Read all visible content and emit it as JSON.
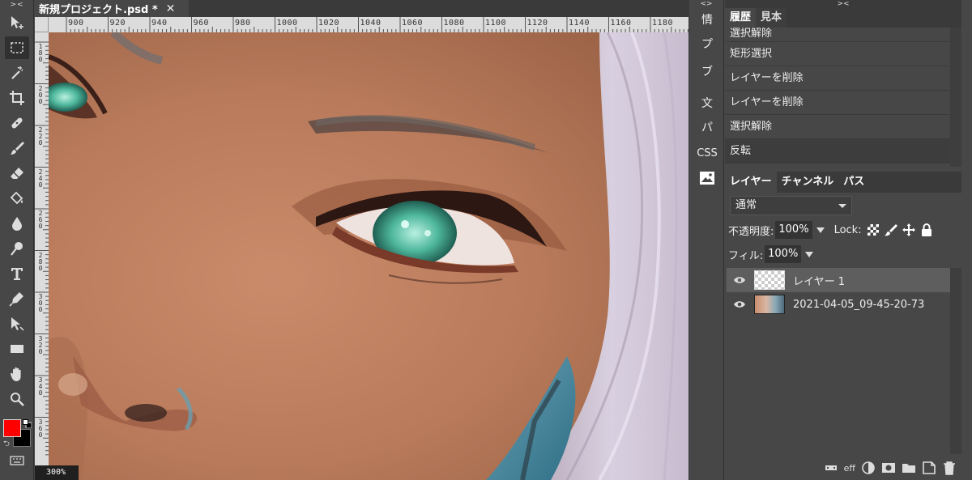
{
  "toolbar": {
    "collapse": "><",
    "tools": [
      "move",
      "marquee",
      "magic-wand",
      "crop",
      "healing",
      "brush",
      "eraser",
      "fill",
      "blur",
      "dodge",
      "type",
      "pen",
      "path-select",
      "shape",
      "hand",
      "zoom"
    ],
    "foreground_color": "#ff0000",
    "background_color": "#000000"
  },
  "document": {
    "tab_title": "新規プロジェクト.psd *",
    "close_glyph": "✕",
    "zoom": "300%"
  },
  "ruler": {
    "top_labels": [
      "900",
      "920",
      "940",
      "960",
      "980",
      "1000",
      "1020",
      "1040",
      "1060",
      "1080",
      "1100",
      "1120",
      "1140",
      "1160",
      "1180"
    ],
    "left_labels": [
      "180",
      "200",
      "220",
      "240",
      "260",
      "280",
      "300",
      "320",
      "340",
      "360"
    ]
  },
  "strip": {
    "collapse": "<>",
    "items": [
      "情",
      "プ",
      "ブ",
      "文",
      "パ",
      "CSS"
    ]
  },
  "right_panel": {
    "collapse": "><",
    "tabs": [
      "履歴",
      "見本"
    ],
    "history": [
      "選択解除",
      "矩形選択",
      "レイヤーを削除",
      "レイヤーを削除",
      "選択解除",
      "反転"
    ],
    "layer_tabs": [
      "レイヤー",
      "チャンネル",
      "パス"
    ],
    "blend_mode": "通常",
    "opacity_label": "不透明度:",
    "opacity_value": "100%",
    "lock_label": "Lock:",
    "fill_label": "フィル:",
    "fill_value": "100%",
    "layers": [
      {
        "name": "レイヤー 1",
        "selected": true,
        "thumb": "transparent"
      },
      {
        "name": "2021-04-05_09-45-20-73",
        "selected": false,
        "thumb": "photo"
      }
    ],
    "footer": {
      "eff": "eff"
    }
  },
  "colors": {
    "panel_bg": "#474747",
    "dark_bg": "#3a3a3a",
    "selected_layer": "#5e5e5e"
  }
}
